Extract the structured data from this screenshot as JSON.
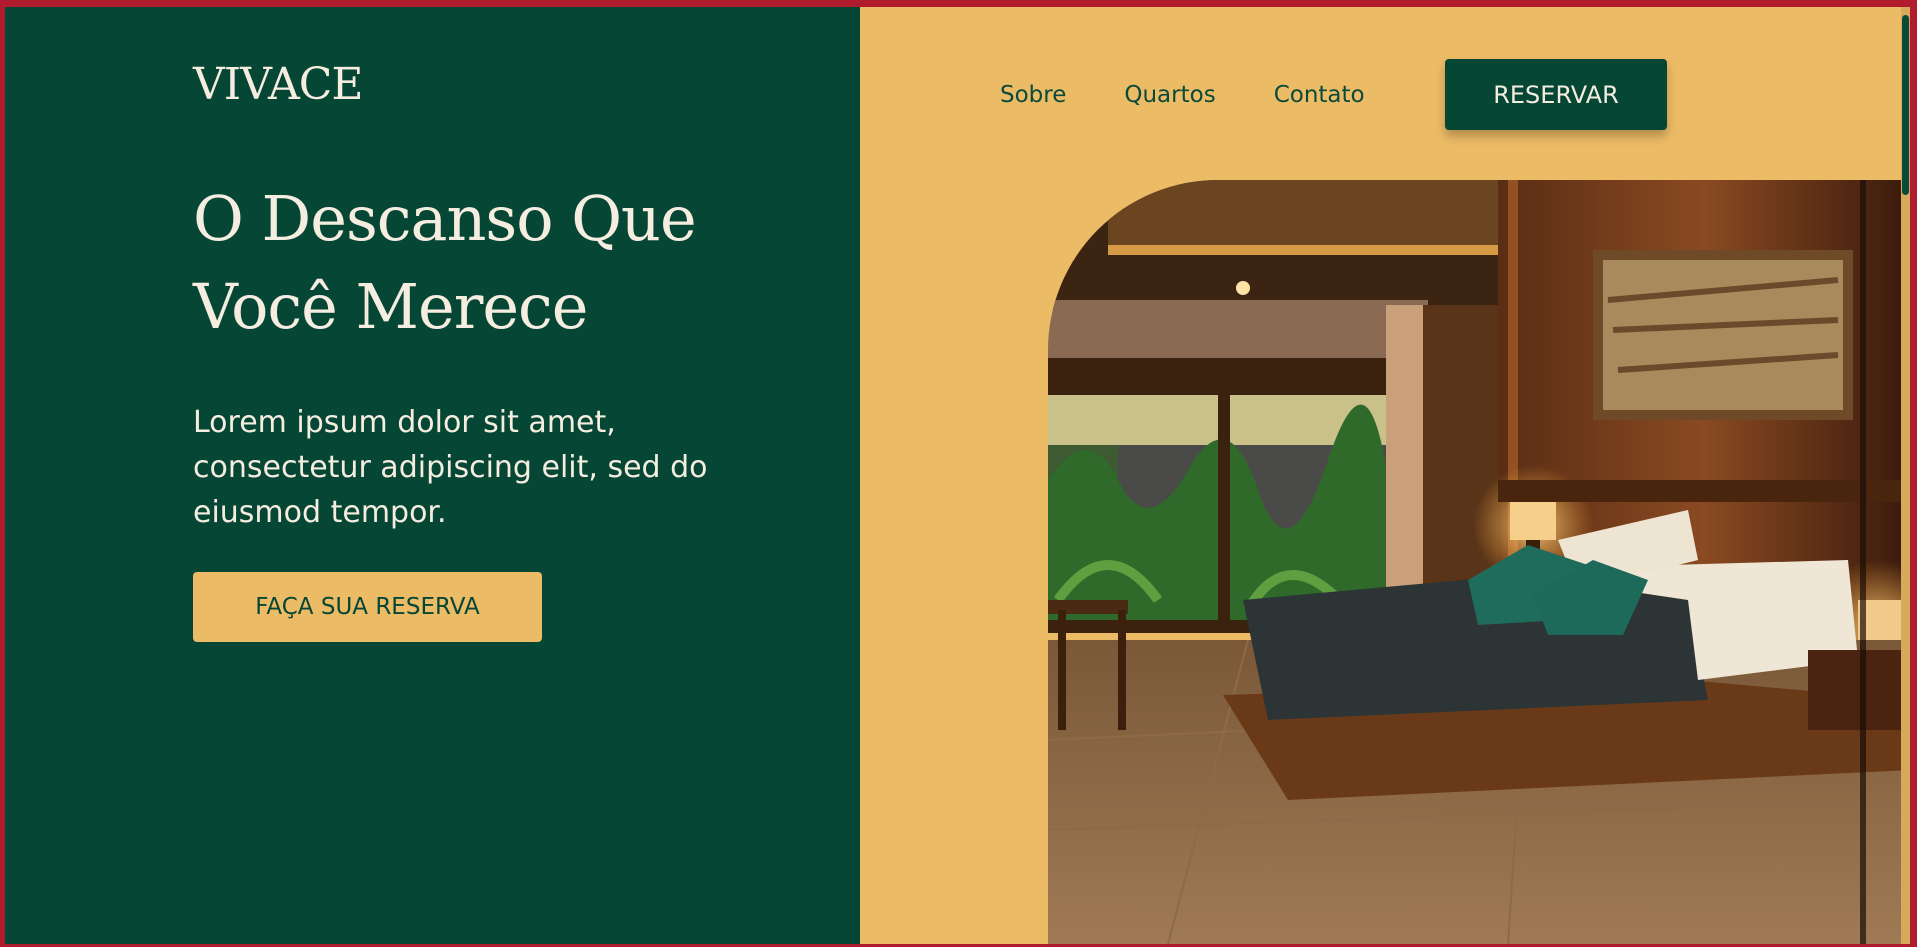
{
  "brand": {
    "logo": "VIVACE"
  },
  "hero": {
    "title_line1": "O Descanso Que",
    "title_line2": "Você Merece",
    "text_line1": "Lorem ipsum dolor sit amet,",
    "text_line2": "consectetur adipiscing elit, sed do",
    "text_line3": "eiusmod tempor.",
    "cta_label": "FAÇA SUA RESERVA"
  },
  "nav": {
    "items": [
      {
        "label": "Sobre"
      },
      {
        "label": "Quartos"
      },
      {
        "label": "Contato"
      }
    ],
    "reserve_label": "RESERVAR"
  },
  "colors": {
    "dark_green": "#064634",
    "mustard": "#ecbb66",
    "cream": "#f4ede0",
    "outer_border": "#b01c2e"
  },
  "image": {
    "subject": "hotel-bedroom-photo"
  }
}
